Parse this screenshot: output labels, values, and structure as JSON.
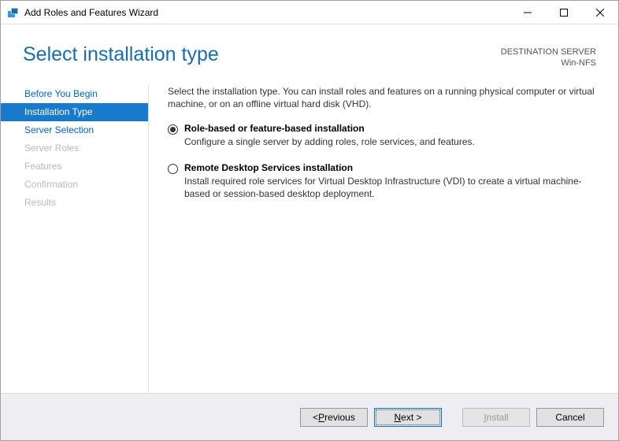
{
  "window": {
    "title": "Add Roles and Features Wizard"
  },
  "header": {
    "page_title": "Select installation type",
    "destination_label": "DESTINATION SERVER",
    "destination_name": "Win-NFS"
  },
  "sidebar": {
    "items": [
      {
        "label": "Before You Begin",
        "state": "normal"
      },
      {
        "label": "Installation Type",
        "state": "active"
      },
      {
        "label": "Server Selection",
        "state": "normal"
      },
      {
        "label": "Server Roles",
        "state": "dim"
      },
      {
        "label": "Features",
        "state": "dim"
      },
      {
        "label": "Confirmation",
        "state": "dim"
      },
      {
        "label": "Results",
        "state": "dim"
      }
    ]
  },
  "main": {
    "intro": "Select the installation type. You can install roles and features on a running physical computer or virtual machine, or on an offline virtual hard disk (VHD).",
    "options": [
      {
        "id": "role-based",
        "title": "Role-based or feature-based installation",
        "desc": "Configure a single server by adding roles, role services, and features.",
        "selected": true
      },
      {
        "id": "rds",
        "title": "Remote Desktop Services installation",
        "desc": "Install required role services for Virtual Desktop Infrastructure (VDI) to create a virtual machine-based or session-based desktop deployment.",
        "selected": false
      }
    ]
  },
  "footer": {
    "previous": "< Previous",
    "next": "Next >",
    "install": "Install",
    "cancel": "Cancel"
  }
}
